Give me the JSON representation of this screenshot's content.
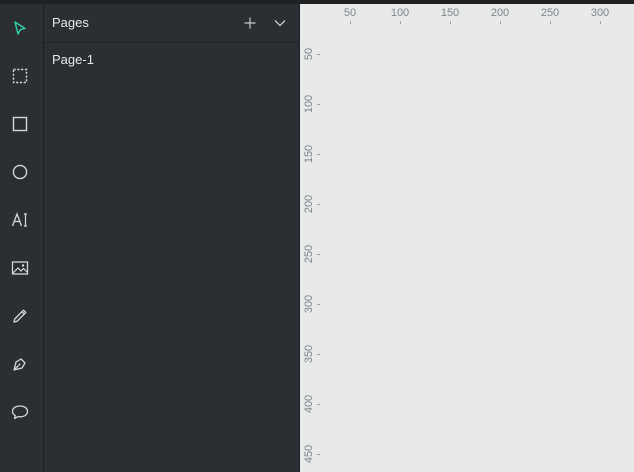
{
  "colors": {
    "accent": "#2fd4a6",
    "icon": "#d5d7da",
    "panel_bg": "#2b2e33",
    "canvas_bg": "#e8e9e9"
  },
  "toolbar": {
    "tools": [
      {
        "name": "move-tool",
        "icon": "cursor-icon",
        "active": true
      },
      {
        "name": "board-tool",
        "icon": "dashed-rectangle-icon"
      },
      {
        "name": "rectangle-tool",
        "icon": "rectangle-icon"
      },
      {
        "name": "ellipse-tool",
        "icon": "circle-icon"
      },
      {
        "name": "text-tool",
        "icon": "text-icon"
      },
      {
        "name": "image-tool",
        "icon": "image-icon"
      },
      {
        "name": "pencil-tool",
        "icon": "pencil-icon"
      },
      {
        "name": "pen-tool",
        "icon": "pen-nib-icon"
      },
      {
        "name": "comment-tool",
        "icon": "speech-bubble-icon"
      }
    ]
  },
  "pages_panel": {
    "title": "Pages",
    "add_icon": "plus-icon",
    "collapse_icon": "chevron-down-icon",
    "pages": [
      {
        "label": "Page-1"
      }
    ]
  },
  "canvas": {
    "ruler_top_labels": [
      "50",
      "100",
      "150",
      "200",
      "250",
      "300"
    ],
    "ruler_left_labels": [
      "50",
      "100",
      "150",
      "200",
      "250",
      "300",
      "350",
      "400",
      "450"
    ]
  }
}
